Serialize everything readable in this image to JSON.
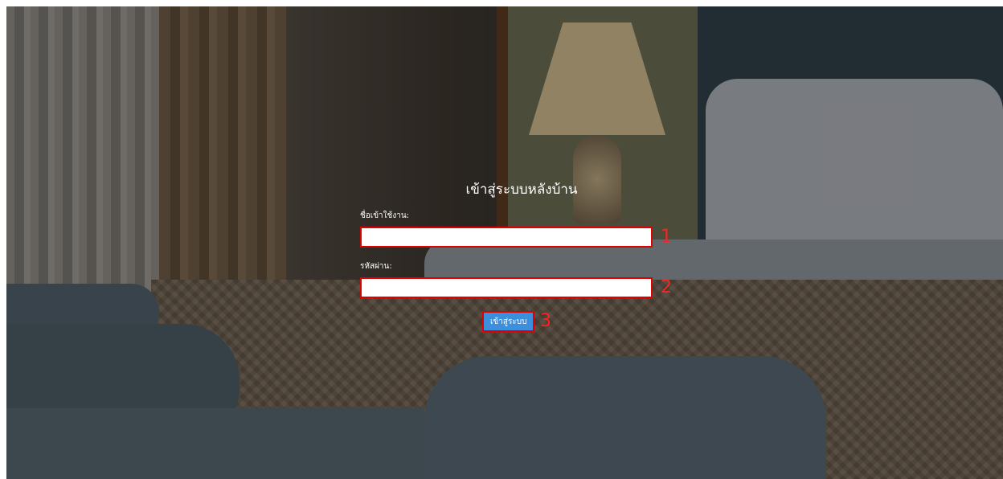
{
  "login": {
    "title": "เข้าสู่ระบบหลังบ้าน",
    "username_label": "ชื่อเข้าใช้งาน:",
    "username_value": "",
    "password_label": "รหัสผ่าน:",
    "password_value": "",
    "submit_label": "เข้าสู่ระบบ"
  },
  "annotations": {
    "marker_1": "1",
    "marker_2": "2",
    "marker_3": "3"
  },
  "colors": {
    "accent": "#3b8fdc",
    "highlight": "#e00000"
  }
}
